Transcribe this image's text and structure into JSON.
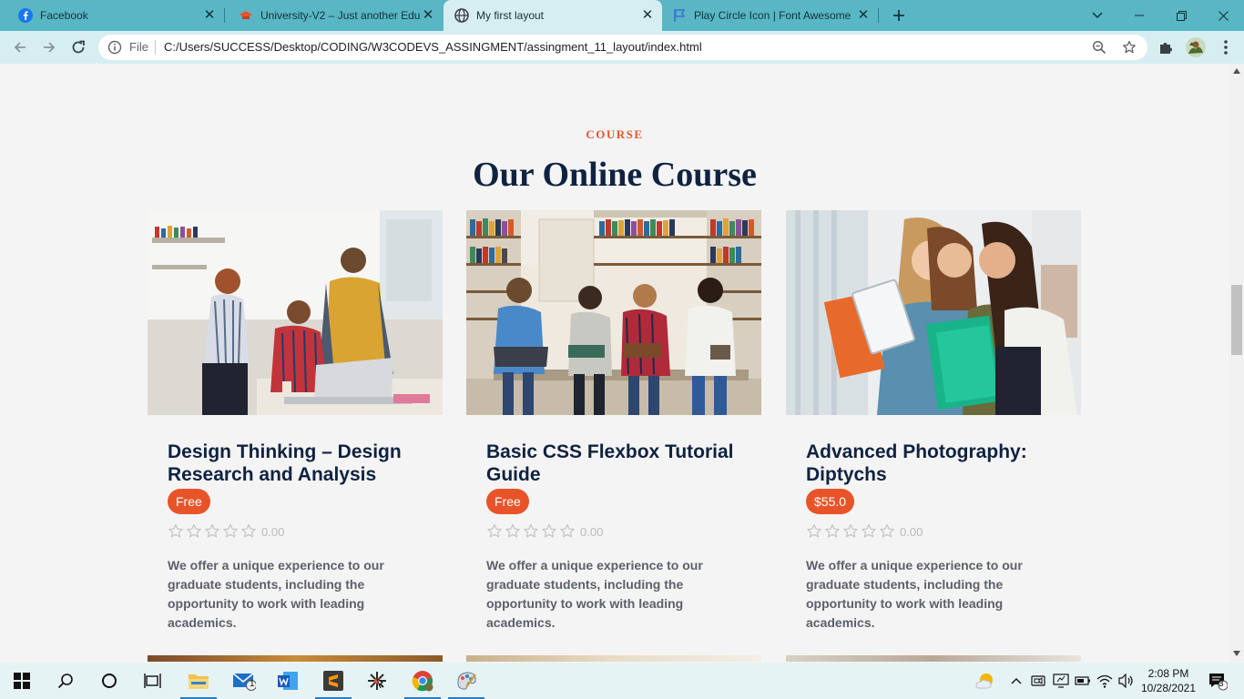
{
  "browser": {
    "tabs": [
      {
        "title": "Facebook",
        "icon": "facebook-icon",
        "active": false
      },
      {
        "title": "University-V2 – Just another Edu",
        "icon": "university-icon",
        "active": false
      },
      {
        "title": "My first layout",
        "icon": "globe-icon",
        "active": true
      },
      {
        "title": "Play Circle Icon | Font Awesome",
        "icon": "flag-icon",
        "active": false
      }
    ],
    "address": {
      "scheme": "File",
      "url": "C:/Users/SUCCESS/Desktop/CODING/W3CODEVS_ASSINGMENT/assingment_11_layout/index.html"
    },
    "colors": {
      "tabstrip": "#59b6c4",
      "toolbar": "#d6eef2"
    }
  },
  "section": {
    "eyebrow": "COURSE",
    "title": "Our Online Course"
  },
  "courses": [
    {
      "title": "Design Thinking – Design Research and Analysis",
      "price": "Free",
      "rating": "0.00",
      "stars": 0,
      "description": "We offer a unique experience to our graduate students, including the opportunity to work with leading academics."
    },
    {
      "title": "Basic CSS Flexbox Tutorial Guide",
      "price": "Free",
      "rating": "0.00",
      "stars": 0,
      "description": "We offer a unique experience to our graduate students, including the opportunity to work with leading academics."
    },
    {
      "title": "Advanced Photography: Diptychs",
      "price": "$55.0",
      "rating": "0.00",
      "stars": 0,
      "description": "We offer a unique experience to our graduate students, including the opportunity to work with leading academics."
    }
  ],
  "taskbar": {
    "time": "2:08 PM",
    "date": "10/28/2021",
    "mail_badge": "1",
    "notification_badge": "3"
  },
  "theme": {
    "accent": "#e8542a",
    "heading": "#0f2240",
    "text": "#5c6068"
  }
}
